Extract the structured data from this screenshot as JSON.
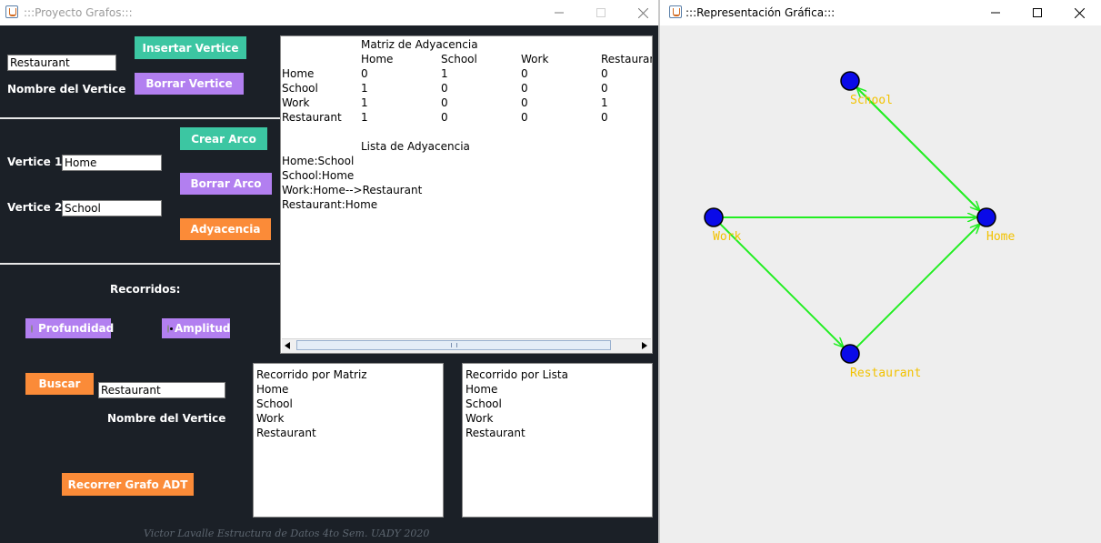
{
  "colors": {
    "panel_bg": "#1b2027",
    "teal": "#3cc6a2",
    "purple": "#b27ff0",
    "orange": "#fb8b38",
    "edge": "#22ee22",
    "node": "#0a0ae8",
    "label": "#f2c200"
  },
  "window1": {
    "title": ":::Proyecto Grafos:::",
    "controls": [
      "minimize-icon",
      "maximize-icon",
      "close-icon"
    ]
  },
  "window2": {
    "title": ":::Representación Gráfica:::",
    "controls": [
      "minimize-icon",
      "maximize-icon",
      "close-icon"
    ]
  },
  "vertex": {
    "input_value": "Restaurant",
    "label": "Nombre del Vertice",
    "insert_btn": "Insertar Vertice",
    "delete_btn": "Borrar Vertice"
  },
  "arc": {
    "v1_label": "Vertice 1:",
    "v1_value": "Home",
    "v2_label": "Vertice 2:",
    "v2_value": "School",
    "create_btn": "Crear Arco",
    "delete_btn": "Borrar Arco",
    "adjacency_btn": "Adyacencia"
  },
  "traversal": {
    "heading": "Recorridos:",
    "depth_label": "Profundidad",
    "breadth_label": "Amplitud",
    "selected": "Amplitud",
    "search_btn": "Buscar",
    "search_value": "Restaurant",
    "search_label": "Nombre del Vertice",
    "run_btn": "Recorrer Grafo ADT"
  },
  "matrix": {
    "title": "Matriz de Adyacencia",
    "headers": [
      "Home",
      "School",
      "Work",
      "Restaurant"
    ],
    "rows": [
      {
        "name": "Home",
        "values": [
          "0",
          "1",
          "0",
          "0"
        ]
      },
      {
        "name": "School",
        "values": [
          "1",
          "0",
          "0",
          "0"
        ]
      },
      {
        "name": "Work",
        "values": [
          "1",
          "0",
          "0",
          "1"
        ]
      },
      {
        "name": "Restaurant",
        "values": [
          "1",
          "0",
          "0",
          "0"
        ]
      }
    ],
    "list_title": "Lista de Adyacencia",
    "list_lines": [
      "Home:School",
      "School:Home",
      "Work:Home-->Restaurant",
      "Restaurant:Home"
    ]
  },
  "result_matrix": {
    "lines": [
      "Recorrido por Matriz",
      "Home",
      "School",
      "Work",
      "Restaurant"
    ]
  },
  "result_list": {
    "lines": [
      "Recorrido por Lista",
      "Home",
      "School",
      "Work",
      "Restaurant"
    ]
  },
  "footer": "Victor Lavalle Estructura de Datos 4to Sem. UADY 2020",
  "graph": {
    "nodes": [
      {
        "id": "School",
        "label": "School"
      },
      {
        "id": "Home",
        "label": "Home"
      },
      {
        "id": "Work",
        "label": "Work"
      },
      {
        "id": "Restaurant",
        "label": "Restaurant"
      }
    ],
    "edges": [
      {
        "from": "School",
        "to": "Home"
      },
      {
        "from": "Home",
        "to": "School"
      },
      {
        "from": "Work",
        "to": "Home"
      },
      {
        "from": "Work",
        "to": "Restaurant"
      },
      {
        "from": "Restaurant",
        "to": "Home"
      }
    ]
  }
}
